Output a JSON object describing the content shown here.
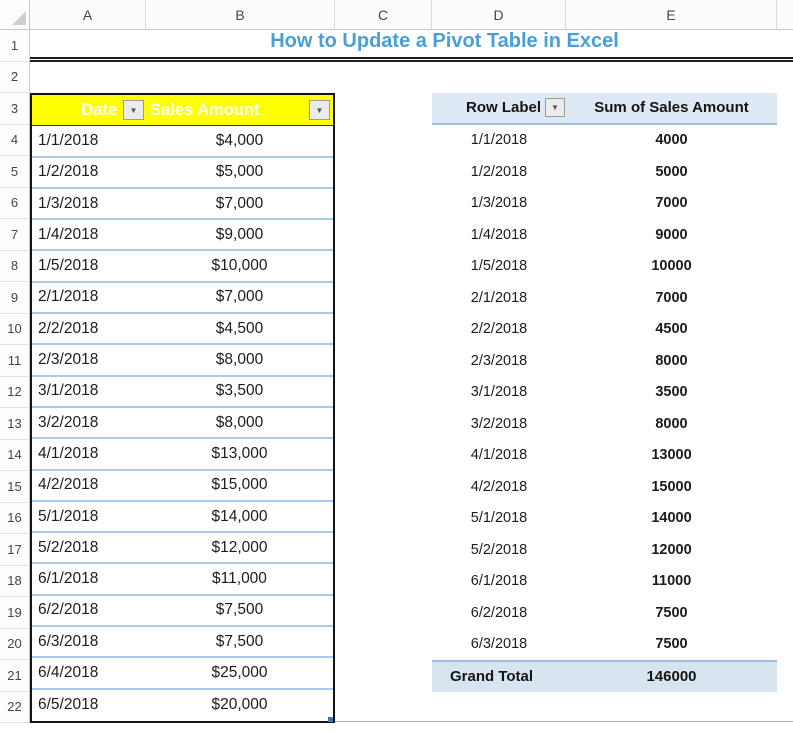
{
  "title": {
    "text": "How to Update a Pivot Table in Excel"
  },
  "grid": {
    "columns": [
      {
        "label": "A"
      },
      {
        "label": "B"
      },
      {
        "label": "C"
      },
      {
        "label": "D"
      },
      {
        "label": "E"
      },
      {
        "label": ""
      }
    ],
    "rows": [
      "1",
      "2",
      "3",
      "4",
      "5",
      "6",
      "7",
      "8",
      "9",
      "10",
      "11",
      "12",
      "13",
      "14",
      "15",
      "16",
      "17",
      "18",
      "19",
      "20",
      "21",
      "22"
    ]
  },
  "sales_table": {
    "headers": {
      "date": "Date",
      "amount": "Sales Amount"
    },
    "rows": [
      [
        "1/1/2018",
        "$4,000"
      ],
      [
        "1/2/2018",
        "$5,000"
      ],
      [
        "1/3/2018",
        "$7,000"
      ],
      [
        "1/4/2018",
        "$9,000"
      ],
      [
        "1/5/2018",
        "$10,000"
      ],
      [
        "2/1/2018",
        "$7,000"
      ],
      [
        "2/2/2018",
        "$4,500"
      ],
      [
        "2/3/2018",
        "$8,000"
      ],
      [
        "3/1/2018",
        "$3,500"
      ],
      [
        "3/2/2018",
        "$8,000"
      ],
      [
        "4/1/2018",
        "$13,000"
      ],
      [
        "4/2/2018",
        "$15,000"
      ],
      [
        "5/1/2018",
        "$14,000"
      ],
      [
        "5/2/2018",
        "$12,000"
      ],
      [
        "6/1/2018",
        "$11,000"
      ],
      [
        "6/2/2018",
        "$7,500"
      ],
      [
        "6/3/2018",
        "$7,500"
      ],
      [
        "6/4/2018",
        "$25,000"
      ],
      [
        "6/5/2018",
        "$20,000"
      ]
    ]
  },
  "pivot_table": {
    "headers": {
      "row_label": "Row Label",
      "value": "Sum of Sales Amount"
    },
    "rows": [
      [
        "1/1/2018",
        "4000"
      ],
      [
        "1/2/2018",
        "5000"
      ],
      [
        "1/3/2018",
        "7000"
      ],
      [
        "1/4/2018",
        "9000"
      ],
      [
        "1/5/2018",
        "10000"
      ],
      [
        "2/1/2018",
        "7000"
      ],
      [
        "2/2/2018",
        "4500"
      ],
      [
        "2/3/2018",
        "8000"
      ],
      [
        "3/1/2018",
        "3500"
      ],
      [
        "3/2/2018",
        "8000"
      ],
      [
        "4/1/2018",
        "13000"
      ],
      [
        "4/2/2018",
        "15000"
      ],
      [
        "5/1/2018",
        "14000"
      ],
      [
        "5/2/2018",
        "12000"
      ],
      [
        "6/1/2018",
        "11000"
      ],
      [
        "6/2/2018",
        "7500"
      ],
      [
        "6/3/2018",
        "7500"
      ]
    ],
    "grand_total": {
      "label": "Grand Total",
      "value": "146000"
    }
  },
  "icons": {
    "filter_dropdown_arrow": "▼"
  },
  "colors": {
    "title_blue": "#4A9FD8",
    "header_yellow": "#FFFF00",
    "header_text": "#FFFFFF",
    "row_line_blue": "#A9CBE9",
    "table_border": "#141414",
    "pivot_border_blue": "#9FBCDD",
    "pivot_header_fill": "#DEE9F5",
    "grand_total_fill": "#D9E4F1",
    "grid_header_border": "#C9C9C9",
    "grid_header_text": "#454545",
    "data_text": "#1C1C1C"
  }
}
